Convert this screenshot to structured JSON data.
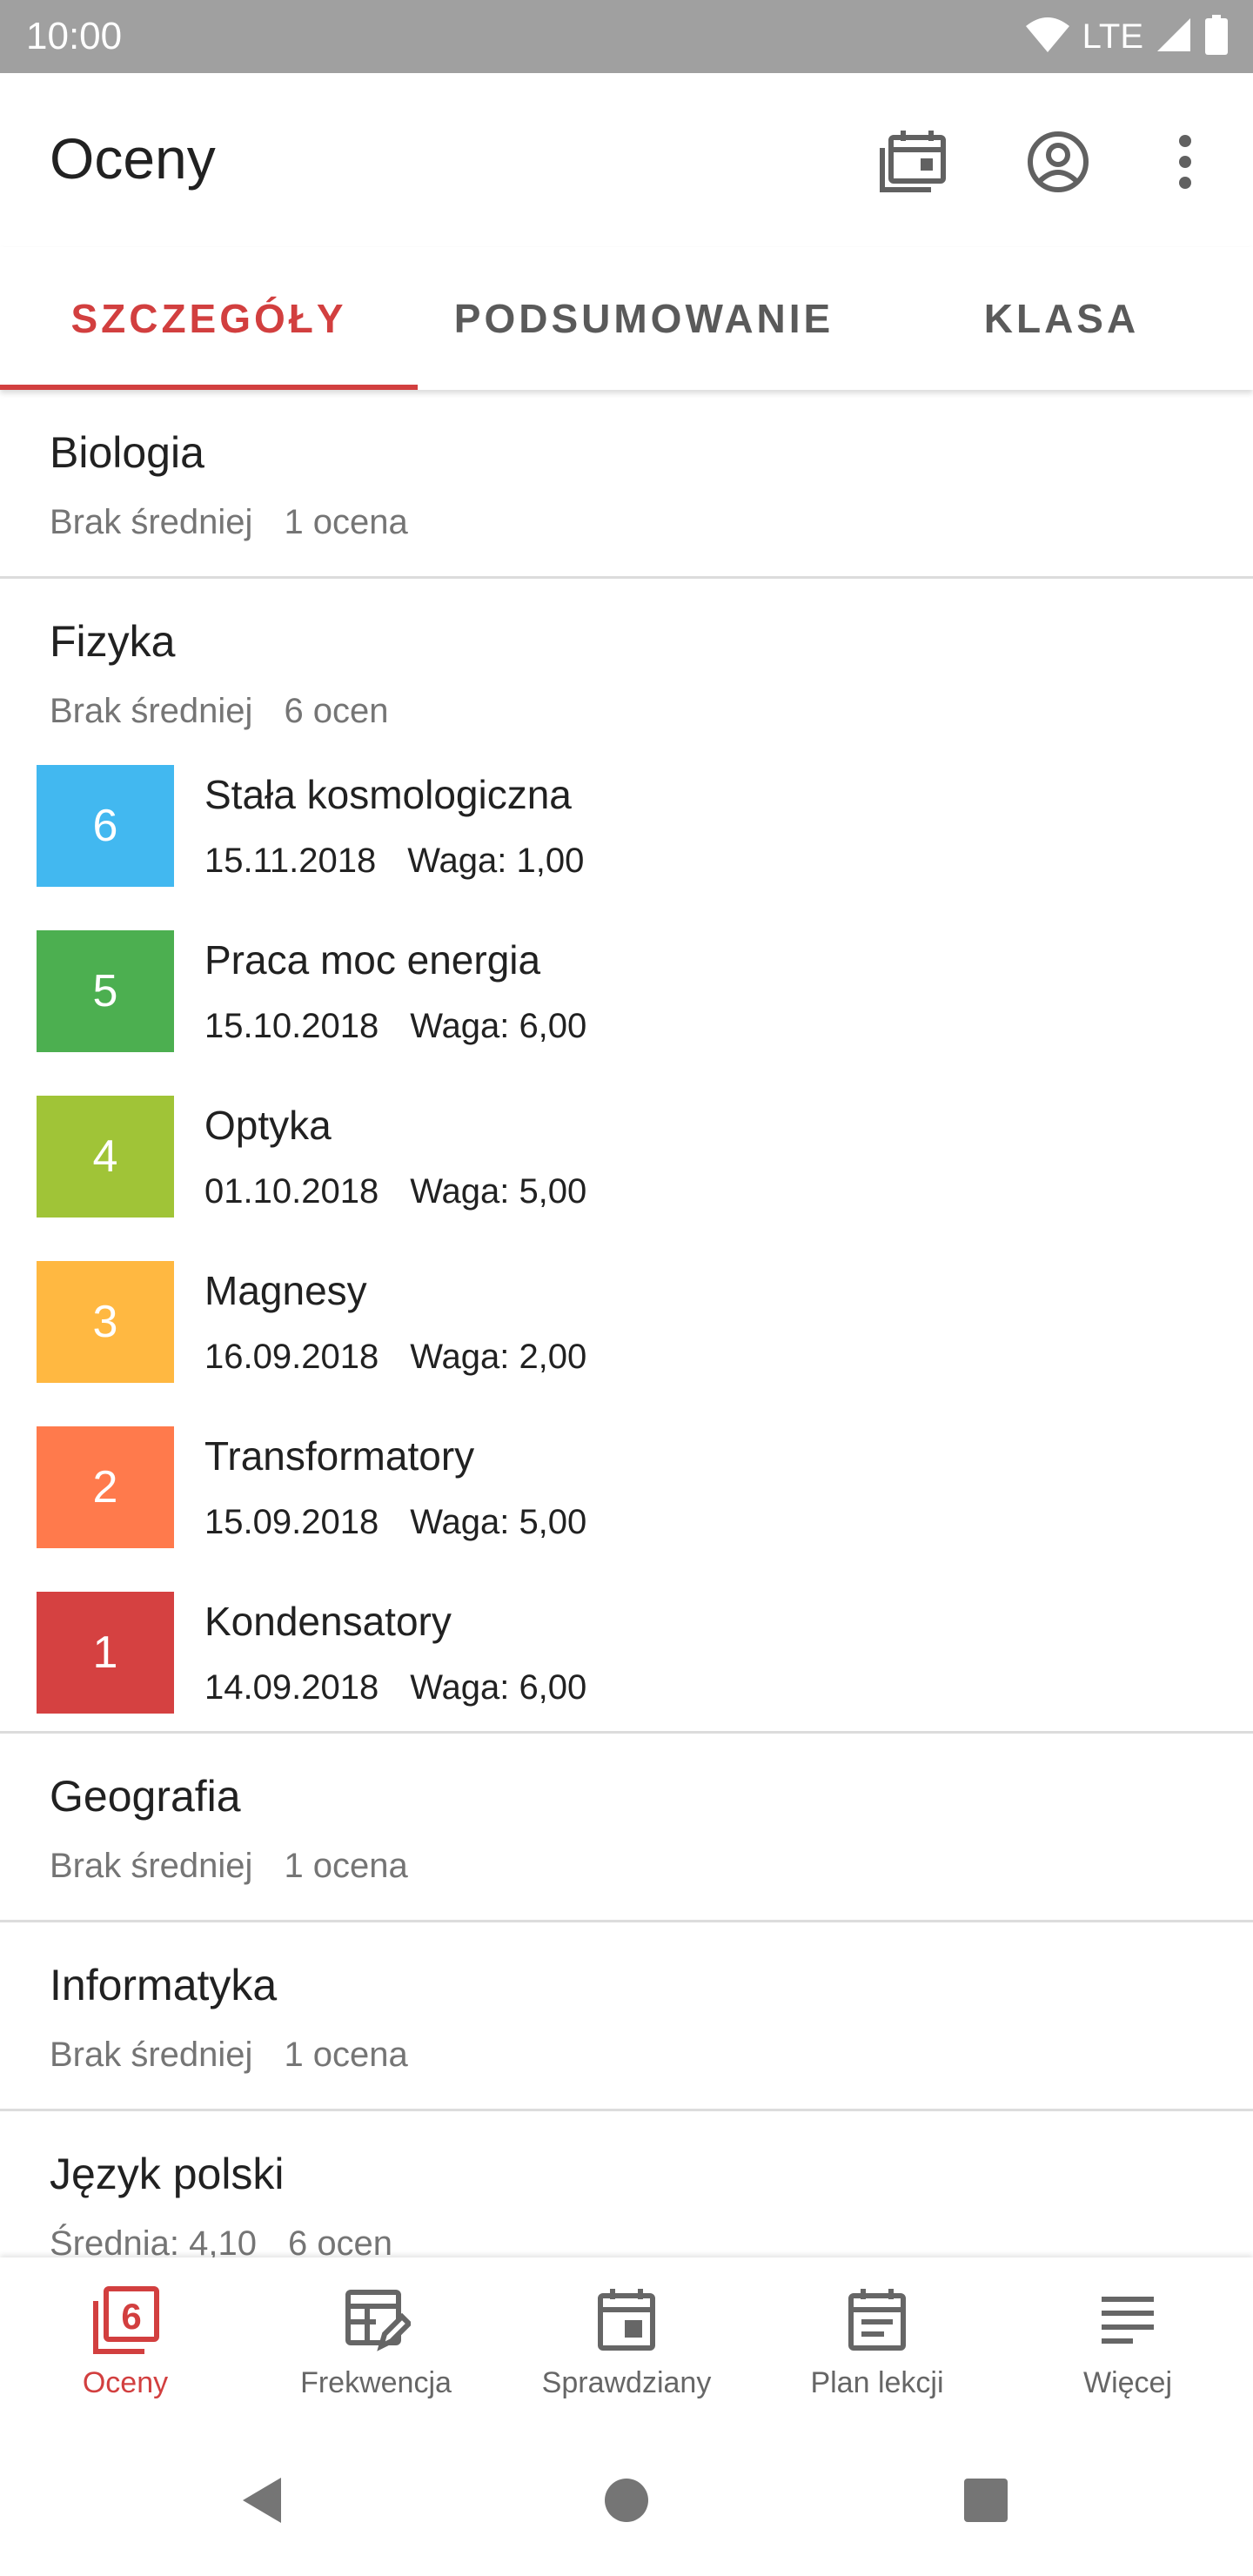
{
  "status_bar": {
    "time": "10:00",
    "network": "LTE",
    "icons": [
      "wifi-icon",
      "signal-icon",
      "battery-icon"
    ]
  },
  "app_bar": {
    "title": "Oceny",
    "actions": [
      "calendar-icon",
      "account-icon",
      "more-vert-icon"
    ]
  },
  "tabs": [
    {
      "label": "SZCZEGÓŁY",
      "active": true
    },
    {
      "label": "PODSUMOWANIE",
      "active": false
    },
    {
      "label": "KLASA",
      "active": false
    }
  ],
  "subjects": [
    {
      "name": "Biologia",
      "average": "Brak średniej",
      "count": "1 ocena"
    },
    {
      "name": "Fizyka",
      "average": "Brak średniej",
      "count": "6 ocen",
      "grades": [
        {
          "value": "6",
          "description": "Stała kosmologiczna",
          "date": "15.11.2018",
          "weight": "Waga: 1,00",
          "color": "#42b8f0"
        },
        {
          "value": "5",
          "description": "Praca moc energia",
          "date": "15.10.2018",
          "weight": "Waga: 6,00",
          "color": "#4caf50"
        },
        {
          "value": "4",
          "description": "Optyka",
          "date": "01.10.2018",
          "weight": "Waga: 5,00",
          "color": "#a0c437"
        },
        {
          "value": "3",
          "description": "Magnesy",
          "date": "16.09.2018",
          "weight": "Waga: 2,00",
          "color": "#ffb841"
        },
        {
          "value": "2",
          "description": "Transformatory",
          "date": "15.09.2018",
          "weight": "Waga: 5,00",
          "color": "#ff7a4c"
        },
        {
          "value": "1",
          "description": "Kondensatory",
          "date": "14.09.2018",
          "weight": "Waga: 6,00",
          "color": "#d54141"
        }
      ]
    },
    {
      "name": "Geografia",
      "average": "Brak średniej",
      "count": "1 ocena"
    },
    {
      "name": "Informatyka",
      "average": "Brak średniej",
      "count": "1 ocena"
    },
    {
      "name": "Język polski",
      "average": "Średnia: 4,10",
      "count": "6 ocen"
    }
  ],
  "bottom_nav": [
    {
      "label": "Oceny",
      "icon": "grades-icon",
      "active": true
    },
    {
      "label": "Frekwencja",
      "icon": "attendance-icon",
      "active": false
    },
    {
      "label": "Sprawdziany",
      "icon": "exams-icon",
      "active": false
    },
    {
      "label": "Plan lekcji",
      "icon": "timetable-icon",
      "active": false
    },
    {
      "label": "Więcej",
      "icon": "more-menu-icon",
      "active": false
    }
  ],
  "colors": {
    "accent": "#d23f3f",
    "status_bar": "#a0a0a0",
    "divider": "#dcdcdc"
  }
}
